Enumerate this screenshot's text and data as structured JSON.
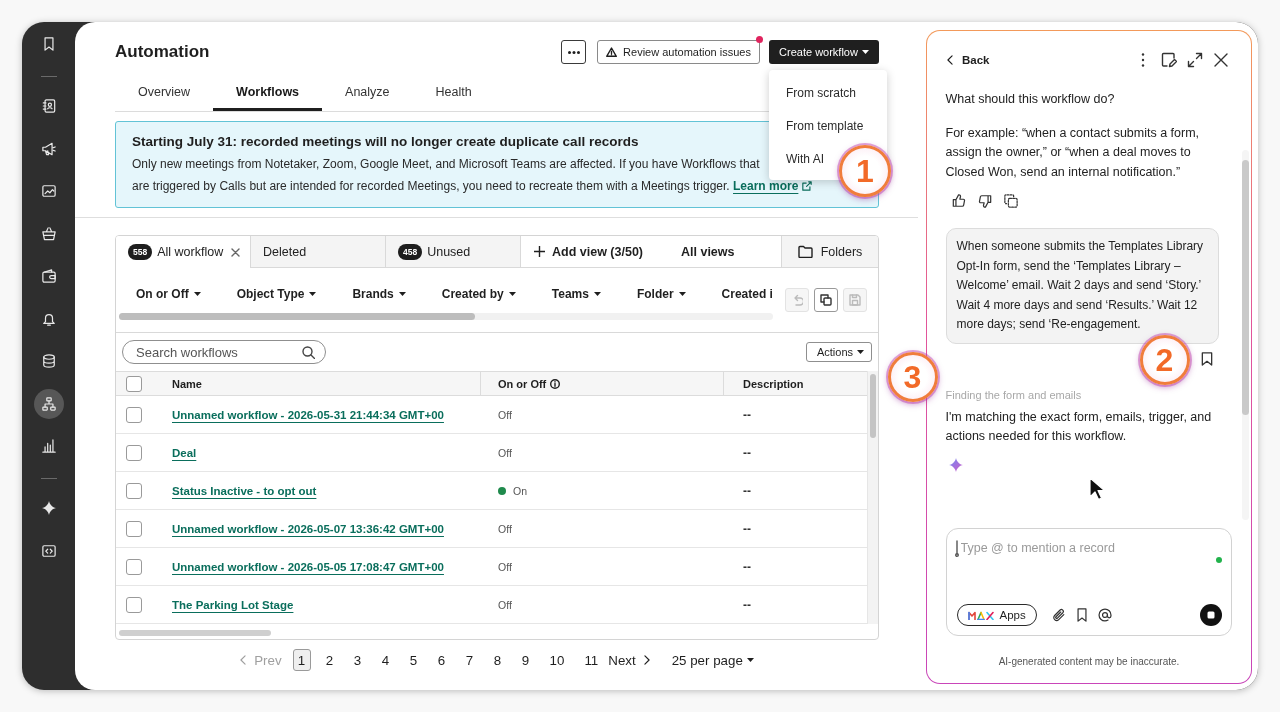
{
  "sidebar": {
    "groups": [
      [
        {
          "selected": false
        }
      ],
      [
        {
          "selected": false
        },
        {
          "selected": false
        },
        {
          "selected": false
        },
        {
          "selected": false
        },
        {
          "selected": false
        },
        {
          "selected": false
        },
        {
          "selected": false
        },
        {
          "selected": true
        },
        {
          "selected": false
        }
      ],
      [
        {
          "selected": false
        },
        {
          "selected": false
        }
      ]
    ]
  },
  "header": {
    "title": "Automation",
    "review_button": {
      "label": "Review automation issues",
      "notification": true
    },
    "create_button": {
      "label": "Create workflow"
    },
    "create_menu": {
      "items": [
        "From scratch",
        "From template",
        "With AI"
      ],
      "annotation": "1"
    }
  },
  "tabs": [
    {
      "label": "Overview",
      "selected": false
    },
    {
      "label": "Workflows",
      "selected": true
    },
    {
      "label": "Analyze",
      "selected": false
    },
    {
      "label": "Health",
      "selected": false
    }
  ],
  "banner": {
    "title": "Starting July 31: recorded meetings will no longer create duplicate call records",
    "body": "Only new meetings from Notetaker, Zoom, Google Meet, and Microsoft Teams are affected. If you have Workflows that are triggered by Calls but are intended for recorded Meetings, you need to recreate them with a Meetings trigger.",
    "link": "Learn more"
  },
  "workflows": {
    "view_tabs": [
      {
        "label": "All workflow",
        "count": "558",
        "selected": true,
        "closable": true
      },
      {
        "label": "Deleted",
        "selected": false
      },
      {
        "label": "Unused",
        "count": "458",
        "selected": false
      }
    ],
    "add_view": "Add view (3/50)",
    "all_views": "All views",
    "folders": "Folders",
    "filters": [
      {
        "label": "On or Off",
        "caret": true
      },
      {
        "label": "Object Type",
        "caret": true
      },
      {
        "label": "Brands",
        "caret": true
      },
      {
        "label": "Created by",
        "caret": true
      },
      {
        "label": "Teams",
        "caret": true
      },
      {
        "label": "Folder",
        "caret": true
      },
      {
        "label": "Created i"
      }
    ],
    "view_actions": [
      {
        "disabled": true
      },
      {
        "disabled": false
      },
      {
        "disabled": true
      }
    ],
    "search": {
      "placeholder": "Search workflows"
    },
    "actions": "Actions",
    "select_all": {
      "checked": false
    },
    "columns": [
      {
        "label": "Name"
      },
      {
        "label": "On or Off",
        "info": true
      },
      {
        "label": "Description"
      }
    ],
    "rows": [
      {
        "name": "Unnamed workflow - 2026-05-31 21:44:34 GMT+00",
        "status": "Off",
        "on": false,
        "description": "--",
        "checked": false
      },
      {
        "name": "Deal",
        "status": "Off",
        "on": false,
        "description": "--",
        "checked": false
      },
      {
        "name": "Status Inactive - to opt out",
        "status": "On",
        "on": true,
        "description": "--",
        "checked": false
      },
      {
        "name": "Unnamed workflow - 2026-05-07 13:36:42 GMT+00",
        "status": "Off",
        "on": false,
        "description": "--",
        "checked": false
      },
      {
        "name": "Unnamed workflow - 2026-05-05 17:08:47 GMT+00",
        "status": "Off",
        "on": false,
        "description": "--",
        "checked": false
      },
      {
        "name": "The Parking Lot Stage",
        "status": "Off",
        "on": false,
        "description": "--",
        "checked": false
      }
    ]
  },
  "pagination": {
    "prev": {
      "label": "Prev",
      "disabled": true
    },
    "pages": [
      {
        "label": "1",
        "selected": true
      },
      {
        "label": "2",
        "selected": false
      },
      {
        "label": "3",
        "selected": false
      },
      {
        "label": "4",
        "selected": false
      },
      {
        "label": "5",
        "selected": false
      },
      {
        "label": "6",
        "selected": false
      },
      {
        "label": "7",
        "selected": false
      },
      {
        "label": "8",
        "selected": false
      },
      {
        "label": "9",
        "selected": false
      },
      {
        "label": "10",
        "selected": false
      },
      {
        "label": "11",
        "selected": false
      }
    ],
    "next": {
      "label": "Next",
      "disabled": false
    },
    "per_page": "25 per page"
  },
  "assistant": {
    "back": "Back",
    "prompt": "What should this workflow do?",
    "example": "For example: “when a contact submits a form, assign the owner,” or “when a deal moves to Closed Won, send an internal notification.”",
    "user_message": {
      "text": "When someone submits the Templates Library Opt-In form, send the ‘Templates Library – Welcome’ email. Wait 2 days and send ‘Story.’ Wait 4 more days and send ‘Results.’ Wait 12 more days; send ‘Re-engagement.",
      "annotation": "2"
    },
    "status": {
      "text": "Finding the form and emails",
      "annotation": "3"
    },
    "reply": "I'm matching the exact form, emails, trigger, and actions needed for this workflow.",
    "composer": {
      "placeholder": "Type @ to mention a record",
      "apps": "Apps",
      "online": true
    },
    "disclaimer": "AI-generated content may be inaccurate."
  }
}
